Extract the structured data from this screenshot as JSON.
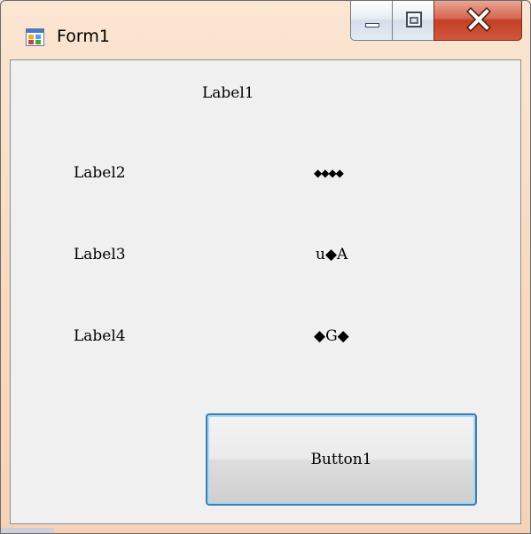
{
  "window": {
    "title": "Form1",
    "controls": {
      "minimize": "minimize-icon",
      "maximize": "maximize-icon",
      "close": "close-icon"
    }
  },
  "form": {
    "label1": "Label1",
    "label2": "Label2",
    "label3": "Label3",
    "label4": "Label4",
    "value1": "◆◆◆◆",
    "value2": "u◆A",
    "value3": "◆G◆",
    "button1": "Button1"
  },
  "colors": {
    "window_frame": "#f8d9c0",
    "client_background": "#f0f0f0",
    "close_button": "#c94a30",
    "button_focus_border": "#3c7fb1"
  }
}
